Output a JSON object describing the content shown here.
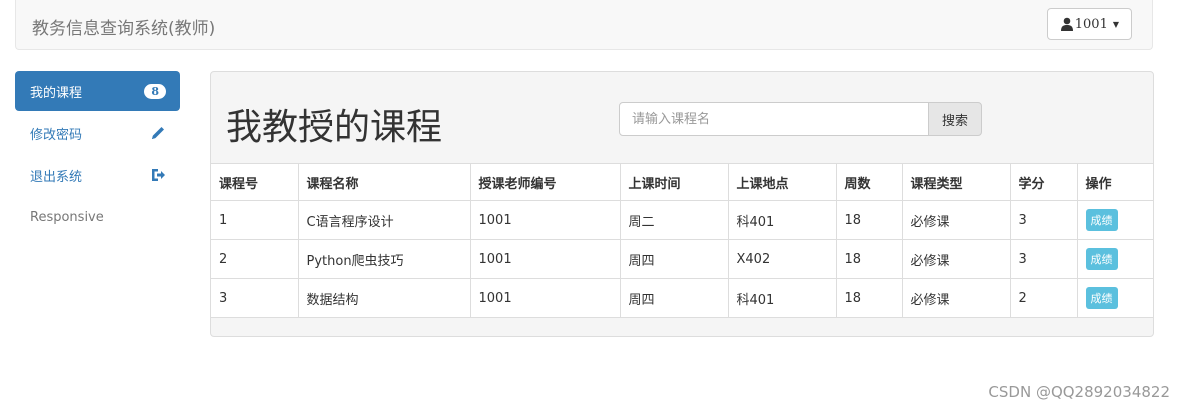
{
  "navbar": {
    "brand": "教务信息查询系统(教师)",
    "user_label": "1001",
    "user_icon": "user-icon"
  },
  "sidebar": {
    "items": [
      {
        "label": "我的课程",
        "badge": "8",
        "active": true
      },
      {
        "label": "修改密码",
        "icon": "pencil-icon"
      },
      {
        "label": "退出系统",
        "icon": "logout-icon"
      },
      {
        "label": "Responsive"
      }
    ]
  },
  "main": {
    "title": "我教授的课程",
    "search": {
      "placeholder": "请输入课程名",
      "button": "搜索"
    },
    "table": {
      "headers": [
        "课程号",
        "课程名称",
        "授课老师编号",
        "上课时间",
        "上课地点",
        "周数",
        "课程类型",
        "学分",
        "操作"
      ],
      "rows": [
        [
          "1",
          "C语言程序设计",
          "1001",
          "周二",
          "科401",
          "18",
          "必修课",
          "3",
          "成绩"
        ],
        [
          "2",
          "Python爬虫技巧",
          "1001",
          "周四",
          "X402",
          "18",
          "必修课",
          "3",
          "成绩"
        ],
        [
          "3",
          "数据结构",
          "1001",
          "周四",
          "科401",
          "18",
          "必修课",
          "2",
          "成绩"
        ]
      ]
    }
  },
  "watermark": "CSDN @QQ2892034822",
  "colors": {
    "primary": "#337ab7",
    "info": "#5bc0de",
    "panel": "#f5f5f5"
  }
}
